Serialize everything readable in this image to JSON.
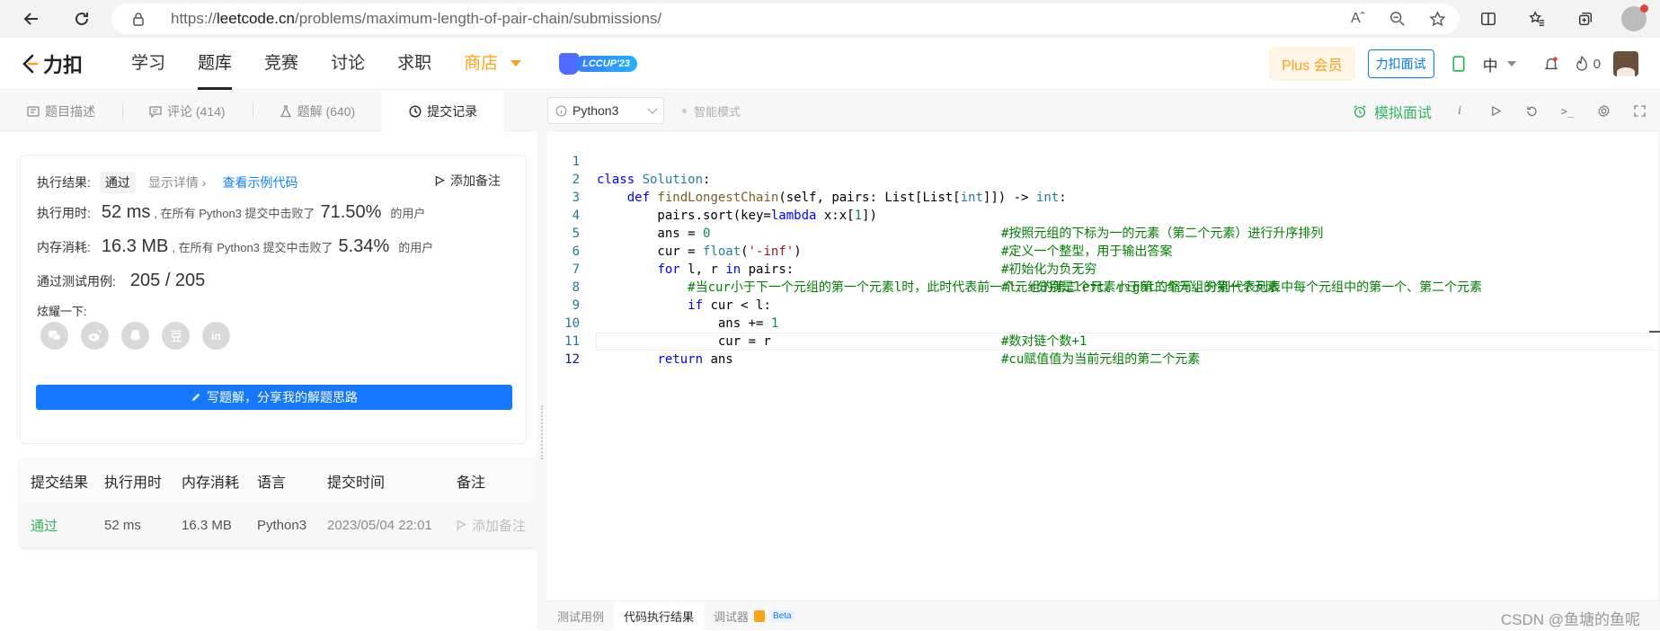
{
  "browser": {
    "url_prefix": "https://",
    "url_host": "leetcode.cn",
    "url_path": "/problems/maximum-length-of-pair-chain/submissions/"
  },
  "header": {
    "logo_text": "力扣",
    "nav": [
      "学习",
      "题库",
      "竞赛",
      "讨论",
      "求职",
      "商店"
    ],
    "lccup_label": "LCCUP'23",
    "plus_label": "Plus 会员",
    "interview_label": "力扣面试",
    "language": "中",
    "points": "0"
  },
  "left_tabs": [
    {
      "label": "题目描述",
      "icon": "document-icon"
    },
    {
      "label": "评论 (414)",
      "icon": "comment-icon"
    },
    {
      "label": "题解 (640)",
      "icon": "flask-icon"
    },
    {
      "label": "提交记录",
      "icon": "clock-icon"
    }
  ],
  "result": {
    "result_label": "执行结果:",
    "status": "通过",
    "show_details": "显示详情 ›",
    "view_sample": "查看示例代码",
    "add_note": "添加备注",
    "runtime_label": "执行用时:",
    "runtime_value": "52 ms",
    "runtime_mid": ", 在所有 Python3 提交中击败了",
    "runtime_pct": "71.50%",
    "runtime_tail": "的用户",
    "memory_label": "内存消耗:",
    "memory_value": "16.3 MB",
    "memory_mid": ", 在所有 Python3 提交中击败了",
    "memory_pct": "5.34%",
    "memory_tail": "的用户",
    "tests_label": "通过测试用例:",
    "tests_value": "205 / 205",
    "share_label": "炫耀一下:",
    "share_icons": [
      "wechat-icon",
      "weibo-icon",
      "qq-icon",
      "douban-icon",
      "linkedin-icon"
    ],
    "write_solution": "写题解，分享我的解题思路"
  },
  "submissions": {
    "headers": [
      "提交结果",
      "执行用时",
      "内存消耗",
      "语言",
      "提交时间",
      "备注"
    ],
    "rows": [
      {
        "status": "通过",
        "runtime": "52 ms",
        "memory": "16.3 MB",
        "language": "Python3",
        "time": "2023/05/04 22:01",
        "note": "添加备注"
      }
    ]
  },
  "editor_toolbar": {
    "language": "Python3",
    "smart_mode": "智能模式",
    "mock_interview": "模拟面试"
  },
  "code": [
    {
      "n": "1",
      "src": "class Solution:",
      "cmt": ""
    },
    {
      "n": "2",
      "src": "    def findLongestChain(self, pairs: List[List[int]]) -> int:",
      "cmt": ""
    },
    {
      "n": "3",
      "src": "        pairs.sort(key=lambda x:x[1])",
      "cmt": "#按照元组的下标为一的元素（第二个元素）进行升序排列"
    },
    {
      "n": "4",
      "src": "        ans = 0",
      "cmt": "#定义一个整型，用于输出答案"
    },
    {
      "n": "5",
      "src": "        cur = float('-inf')",
      "cmt": "#初始化为负无穷"
    },
    {
      "n": "6",
      "src": "        for l, r in pairs:",
      "cmt": "#l、r分别是left、right的缩写，分别代表列表中每个元组中的第一个、第二个元素"
    },
    {
      "n": "7",
      "src": "            #当cur小于下一个元组的第一个元素l时，此时代表前一个元组的第二个元素小于第二个元组的第一个元素",
      "cmt": ""
    },
    {
      "n": "8",
      "src": "            if cur < l:",
      "cmt": ""
    },
    {
      "n": "9",
      "src": "                ans += 1",
      "cmt": "#数对链个数+1"
    },
    {
      "n": "10",
      "src": "                cur = r",
      "cmt": "#cu赋值值为当前元组的第二个元素"
    },
    {
      "n": "11",
      "src": "        return ans",
      "cmt": ""
    },
    {
      "n": "12",
      "src": "",
      "cmt": ""
    }
  ],
  "console_tabs": [
    "测试用例",
    "代码执行结果",
    "调试器"
  ],
  "beta_label": "Beta",
  "watermark": "CSDN @鱼塘的鱼呢",
  "colors": {
    "accent": "#1677ff",
    "success": "#2db55d",
    "shop": "#ffa116"
  }
}
